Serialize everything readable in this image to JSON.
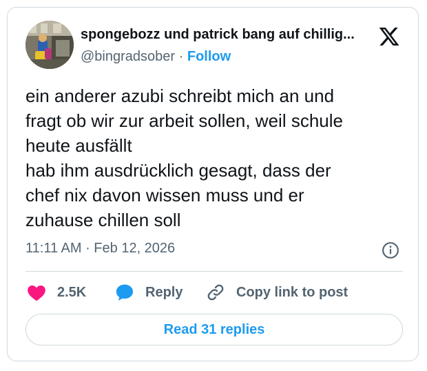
{
  "author": {
    "display_name": "spongebozz und patrick bang auf chillig...",
    "handle": "@bingradsober",
    "separator": "·",
    "follow_label": "Follow"
  },
  "tweet": {
    "lines": [
      "ein anderer azubi schreibt mich an und",
      "fragt ob wir zur arbeit sollen, weil schule",
      "heute ausfällt",
      "hab ihm ausdrücklich gesagt, dass der",
      "chef nix davon wissen muss und er",
      "zuhause chillen soll"
    ],
    "timestamp": "11:11 AM · Feb 12, 2026"
  },
  "actions": {
    "likes": "2.5K",
    "reply_label": "Reply",
    "copy_link_label": "Copy link to post",
    "read_replies_label": "Read 31 replies"
  },
  "icons": {
    "brand": "x-logo-icon",
    "info": "info-icon",
    "like": "heart-icon",
    "reply": "speech-bubble-icon",
    "copy": "link-icon"
  },
  "colors": {
    "accent": "#1d9bf0",
    "like": "#f91880",
    "text": "#0f1419",
    "secondary": "#536471",
    "border": "#cfd9de"
  }
}
